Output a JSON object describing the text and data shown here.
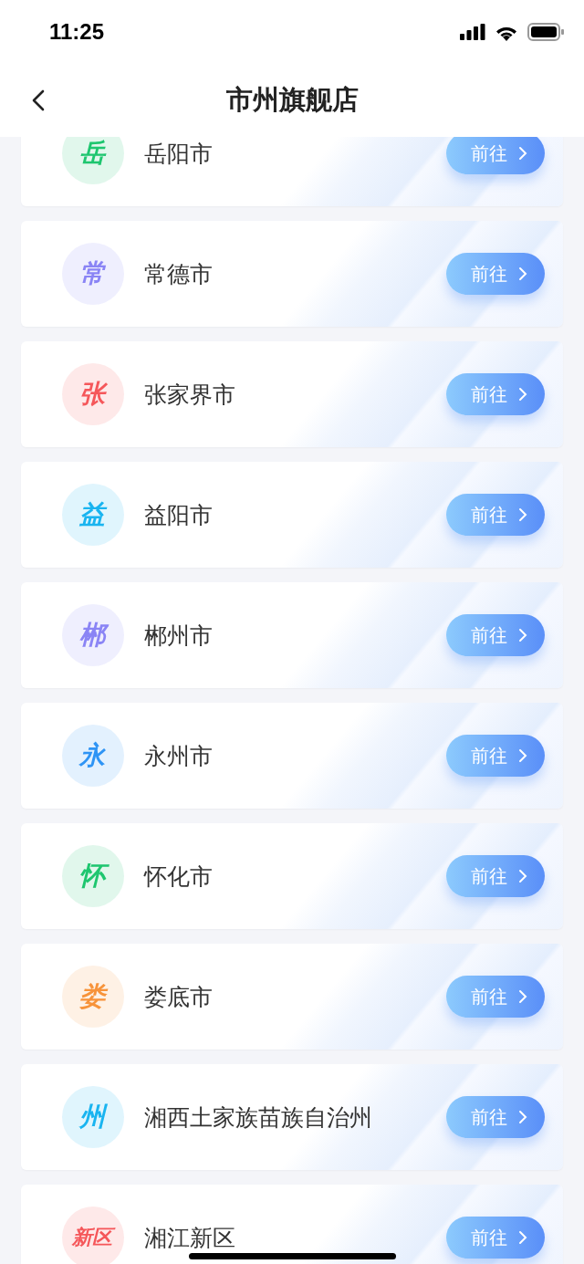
{
  "status_bar": {
    "time": "11:25"
  },
  "nav": {
    "title": "市州旗舰店"
  },
  "stores": [
    {
      "badge": "岳",
      "name": "岳阳市",
      "color": "#1ec66f",
      "button": "前往"
    },
    {
      "badge": "常",
      "name": "常德市",
      "color": "#8a84f5",
      "button": "前往"
    },
    {
      "badge": "张",
      "name": "张家界市",
      "color": "#f5575a",
      "button": "前往"
    },
    {
      "badge": "益",
      "name": "益阳市",
      "color": "#19b4f0",
      "button": "前往"
    },
    {
      "badge": "郴",
      "name": "郴州市",
      "color": "#8a84f5",
      "button": "前往"
    },
    {
      "badge": "永",
      "name": "永州市",
      "color": "#2e94f5",
      "button": "前往"
    },
    {
      "badge": "怀",
      "name": "怀化市",
      "color": "#1ec66f",
      "button": "前往"
    },
    {
      "badge": "娄",
      "name": "娄底市",
      "color": "#f7933a",
      "button": "前往"
    },
    {
      "badge": "州",
      "name": "湘西土家族苗族自治州",
      "color": "#19b4f0",
      "button": "前往"
    },
    {
      "badge": "新区",
      "name": "湘江新区",
      "color": "#f5575a",
      "button": "前往"
    }
  ]
}
